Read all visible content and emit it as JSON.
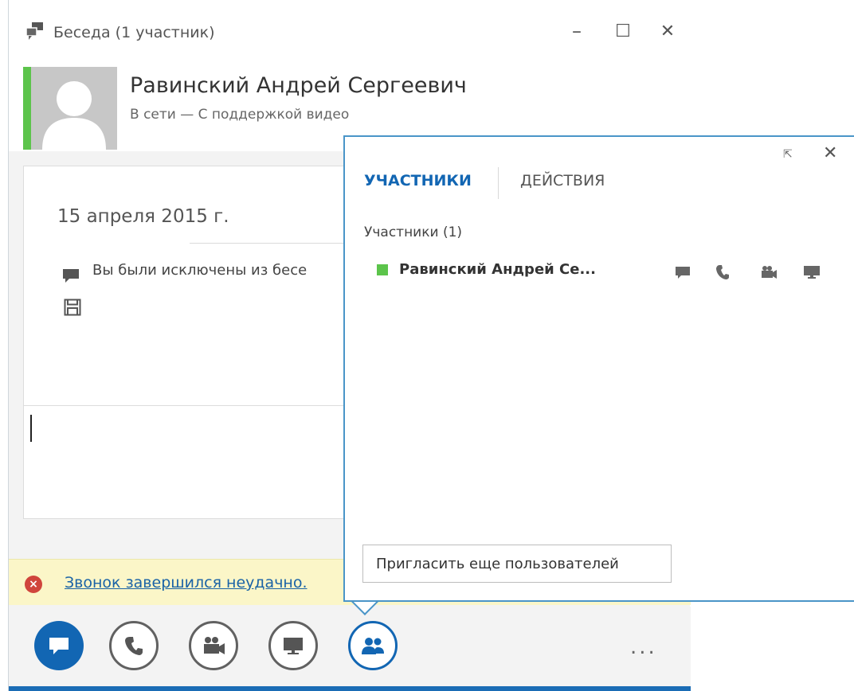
{
  "window": {
    "title": "Беседа (1 участник)",
    "buttons": {
      "minimize": "–",
      "maximize": "☐",
      "close": "✕"
    }
  },
  "contact": {
    "name": "Равинский Андрей Сергеевич",
    "status": "В сети — С поддержкой видео",
    "presence_color": "#5cc44b"
  },
  "chat": {
    "date": "15 апреля 2015 г.",
    "message": "Вы были исключены из бесе",
    "compose_value": ""
  },
  "error": {
    "icon": "×",
    "text": "Звонок завершился неудачно."
  },
  "toolbar": {
    "more": "...",
    "accent": "#1266b3"
  },
  "panel": {
    "popout": "⇱",
    "close": "✕",
    "tabs": [
      "УЧАСТНИКИ",
      "ДЕЙСТВИЯ"
    ],
    "participants_heading": "Участники (1)",
    "participant": {
      "name": "Равинский Андрей Се...",
      "presence_color": "#5cc44b"
    },
    "invite_label": "Пригласить еще пользователей",
    "border_color": "#4a95c8"
  },
  "icons": {
    "title": "conversation-icon",
    "message": "chat-bubble-icon",
    "save": "save-icon",
    "error": "error-circle-icon",
    "im": "chat-bubble-icon",
    "phone": "phone-icon",
    "video": "video-camera-icon",
    "present": "monitor-icon",
    "people": "people-icon"
  }
}
